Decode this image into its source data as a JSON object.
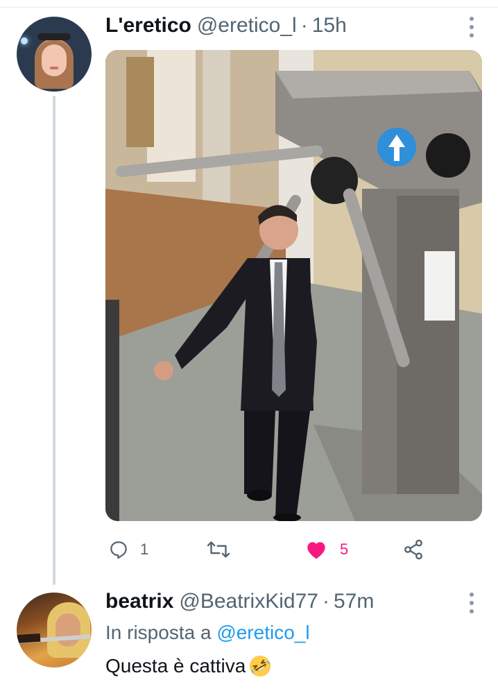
{
  "tweet": {
    "display_name": "L'eretico",
    "handle": "@eretico_l",
    "separator": "·",
    "time": "15h",
    "image_description_icon": "photo-turnstile",
    "actions": {
      "reply_icon": "reply-icon",
      "reply_count": "1",
      "retweet_icon": "retweet-icon",
      "retweet_count": "",
      "like_icon": "heart-filled-icon",
      "like_count": "5",
      "share_icon": "share-icon"
    }
  },
  "reply": {
    "display_name": "beatrix",
    "handle": "@BeatrixKid77",
    "separator": "·",
    "time": "57m",
    "reply_prefix": "In risposta a",
    "reply_mention": "@eretico_l",
    "text": "Questa è cattiva",
    "emoji": "rolling-on-floor-laughing-emoji"
  },
  "colors": {
    "text_primary": "#0f1419",
    "text_secondary": "#536471",
    "link": "#1d9bf0",
    "like_active": "#f91880",
    "thread_line": "#cfd9de"
  }
}
